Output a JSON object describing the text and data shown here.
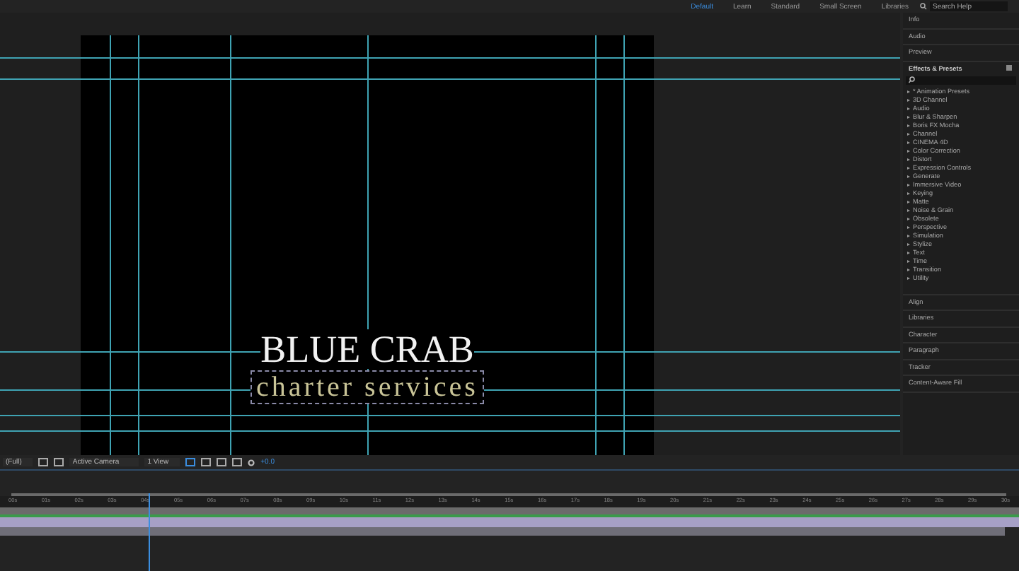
{
  "workspace_bar": {
    "tabs": [
      {
        "label": "Default",
        "selected": true
      },
      {
        "label": "Learn",
        "selected": false
      },
      {
        "label": "Standard",
        "selected": false
      },
      {
        "label": "Small Screen",
        "selected": false
      },
      {
        "label": "Libraries",
        "selected": false
      }
    ],
    "search": {
      "placeholder": "Search Help"
    }
  },
  "composition": {
    "title": "BLUE CRAB",
    "subtitle": "charter services"
  },
  "viewer_controls": {
    "resolution": "(Full)",
    "camera": "Active Camera",
    "views": "1 View",
    "exposure": "+0.0"
  },
  "side_panels_top": [
    "Info",
    "Audio",
    "Preview"
  ],
  "effects_presets": {
    "title": "Effects & Presets",
    "categories": [
      "* Animation Presets",
      "3D Channel",
      "Audio",
      "Blur & Sharpen",
      "Boris FX Mocha",
      "Channel",
      "CINEMA 4D",
      "Color Correction",
      "Distort",
      "Expression Controls",
      "Generate",
      "Immersive Video",
      "Keying",
      "Matte",
      "Noise & Grain",
      "Obsolete",
      "Perspective",
      "Simulation",
      "Stylize",
      "Text",
      "Time",
      "Transition",
      "Utility"
    ]
  },
  "side_panels_bottom": [
    "Align",
    "Libraries",
    "Character",
    "Paragraph",
    "Tracker",
    "Content-Aware Fill"
  ],
  "timeline": {
    "ticks": [
      "00s",
      "01s",
      "02s",
      "03s",
      "04s",
      "05s",
      "06s",
      "07s",
      "08s",
      "09s",
      "10s",
      "11s",
      "12s",
      "13s",
      "14s",
      "15s",
      "16s",
      "17s",
      "18s",
      "19s",
      "20s",
      "21s",
      "22s",
      "23s",
      "24s",
      "25s",
      "26s",
      "27s",
      "28s",
      "29s",
      "30s"
    ],
    "playhead": {
      "level": 0.14
    }
  }
}
